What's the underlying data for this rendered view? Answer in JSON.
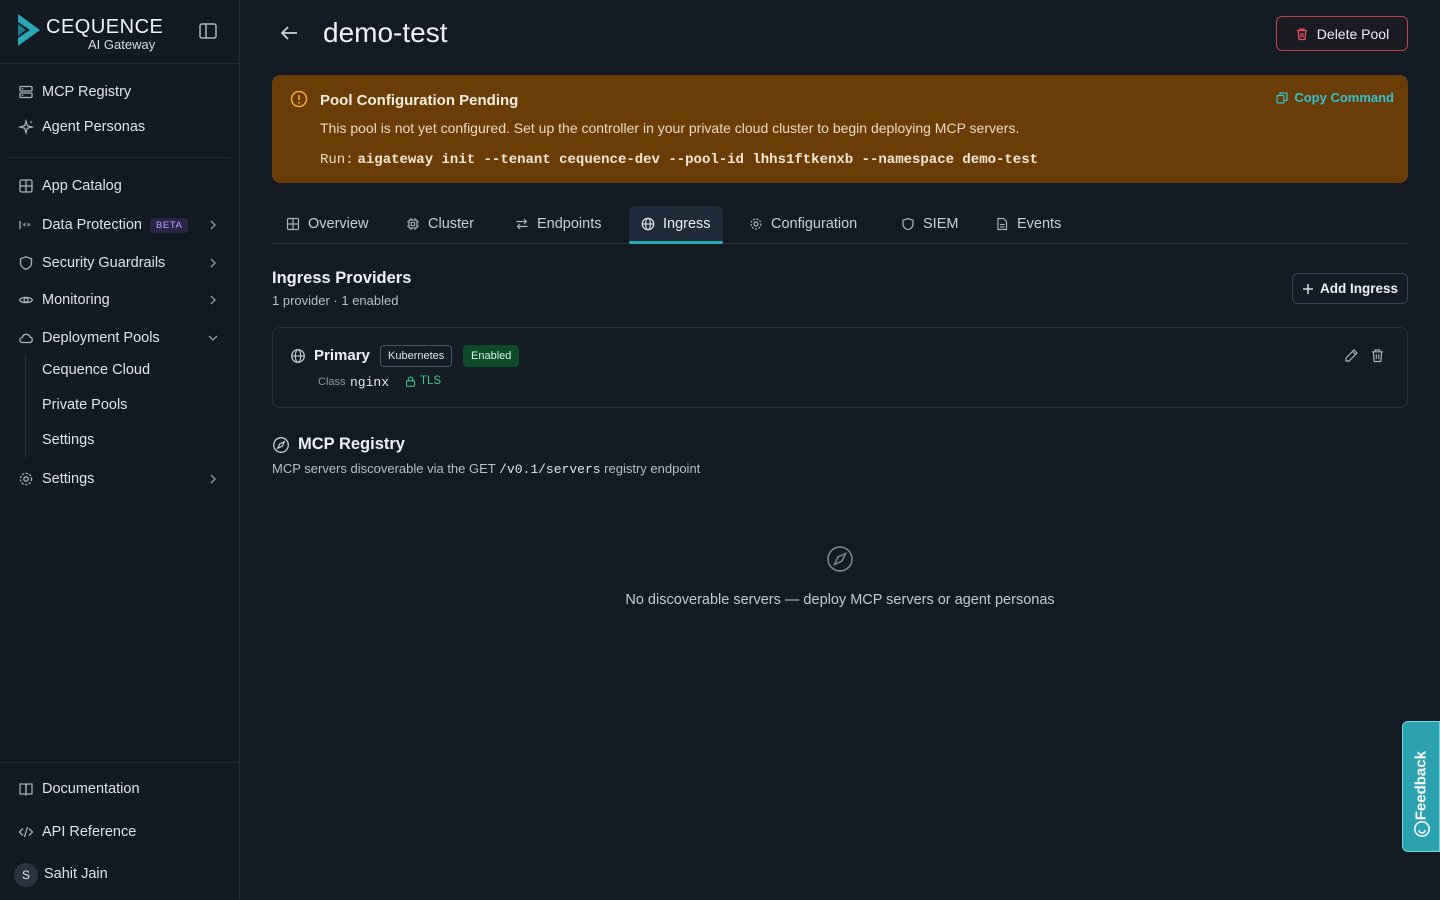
{
  "brand": {
    "name": "CEQUENCE",
    "subtitle": "AI Gateway",
    "color": "#2aa7b5"
  },
  "sidebar": {
    "top_items": [
      {
        "label": "MCP Registry",
        "icon": "server-icon"
      },
      {
        "label": "Agent Personas",
        "icon": "sparkle-icon"
      }
    ],
    "items": [
      {
        "label": "App Catalog",
        "icon": "grid-icon"
      },
      {
        "label": "Data Protection",
        "icon": "asterisk-icon",
        "badge": "BETA"
      },
      {
        "label": "Security Guardrails",
        "icon": "shield-icon"
      },
      {
        "label": "Monitoring",
        "icon": "eye-icon"
      },
      {
        "label": "Deployment Pools",
        "icon": "cloud-icon",
        "expanded": true
      },
      {
        "label": "Settings",
        "icon": "gear-icon"
      }
    ],
    "sub_items": [
      "Cequence Cloud",
      "Private Pools",
      "Settings"
    ],
    "bottom_items": [
      {
        "label": "Documentation",
        "icon": "book-icon"
      },
      {
        "label": "API Reference",
        "icon": "code-icon"
      }
    ],
    "user": {
      "initial": "S",
      "name": "Sahit Jain"
    }
  },
  "header": {
    "title": "demo-test",
    "delete_label": "Delete Pool"
  },
  "banner": {
    "title": "Pool Configuration Pending",
    "description": "This pool is not yet configured. Set up the controller in your private cloud cluster to begin deploying MCP servers.",
    "run_label": "Run:",
    "command": "aigateway init --tenant cequence-dev --pool-id lhhs1ftkenxb --namespace demo-test",
    "copy_label": "Copy Command",
    "color": "#6a3c06"
  },
  "tabs": [
    {
      "label": "Overview",
      "icon": "grid-icon"
    },
    {
      "label": "Cluster",
      "icon": "chip-icon"
    },
    {
      "label": "Endpoints",
      "icon": "arrows-icon"
    },
    {
      "label": "Ingress",
      "icon": "globe-icon",
      "active": true
    },
    {
      "label": "Configuration",
      "icon": "gear-icon"
    },
    {
      "label": "SIEM",
      "icon": "shield-icon"
    },
    {
      "label": "Events",
      "icon": "document-icon"
    }
  ],
  "ingress": {
    "title": "Ingress Providers",
    "summary": "1 provider · 1 enabled",
    "add_label": "Add Ingress",
    "providers": [
      {
        "name": "Primary",
        "type": "Kubernetes",
        "status": "Enabled",
        "class_label": "Class",
        "class_value": "nginx",
        "tls": "TLS"
      }
    ]
  },
  "registry": {
    "title": "MCP Registry",
    "desc_prefix": "MCP servers discoverable via the GET",
    "endpoint": "/v0.1/servers",
    "desc_suffix": "registry endpoint",
    "empty_text": "No discoverable servers — deploy MCP servers or agent personas"
  },
  "feedback": {
    "label": "Feedback"
  }
}
